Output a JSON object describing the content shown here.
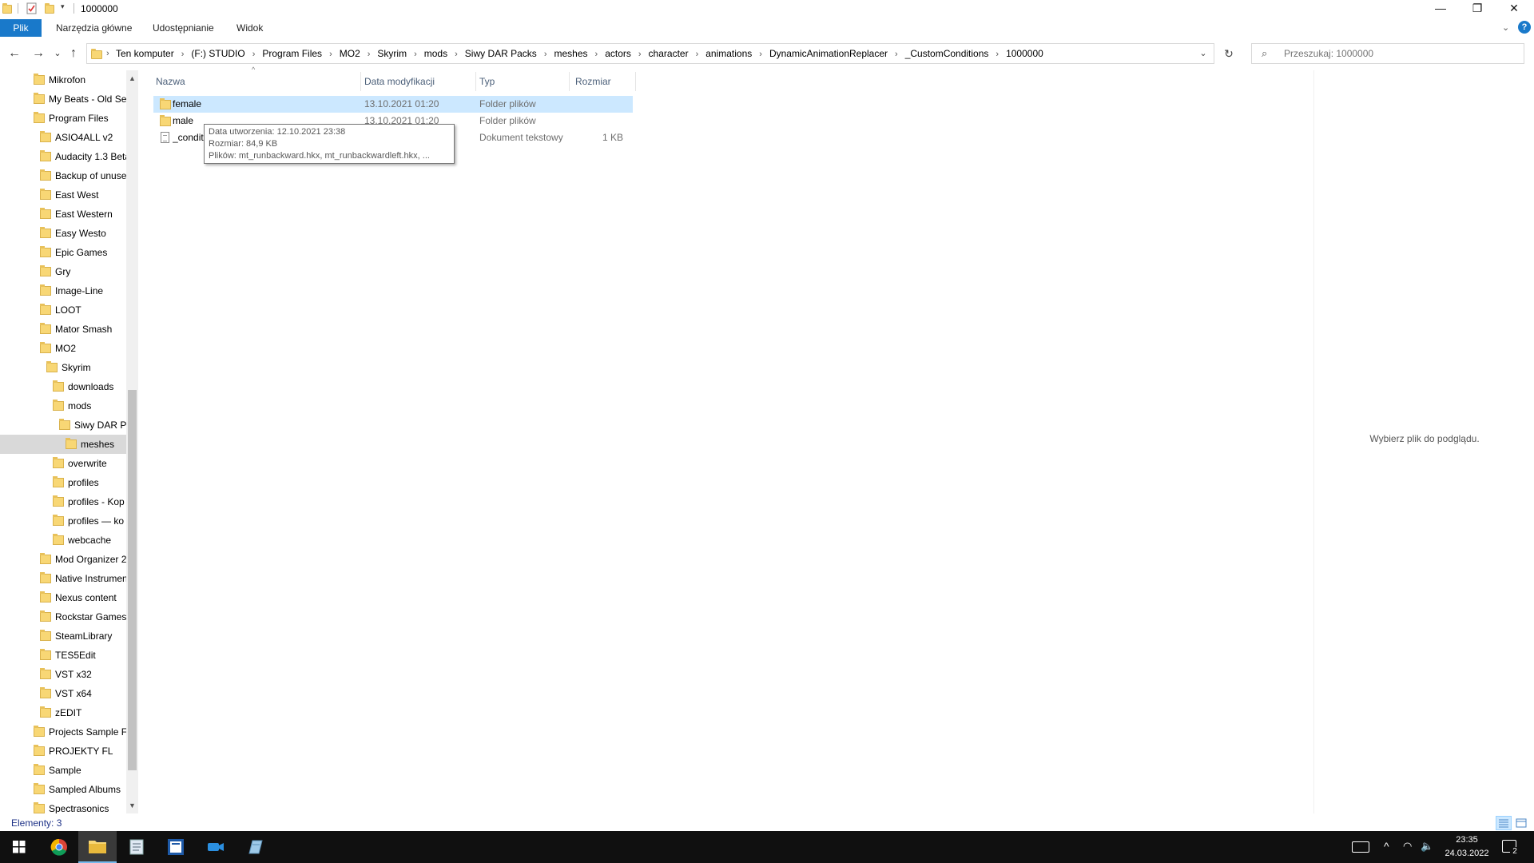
{
  "window": {
    "title": "1000000",
    "minimize_label": "—",
    "maximize_label": "❐",
    "close_label": "✕"
  },
  "ribbon": {
    "tabs": [
      "Plik",
      "Narzędzia główne",
      "Udostępnianie",
      "Widok"
    ],
    "expand_icon": "chevron-down-icon",
    "help_label": "?"
  },
  "address": {
    "back_label": "←",
    "forward_label": "→",
    "recent_label": "⌄",
    "up_label": "↑",
    "crumbs": [
      "Ten komputer",
      "(F:) STUDIO",
      "Program Files",
      "MO2",
      "Skyrim",
      "mods",
      "Siwy DAR Packs",
      "meshes",
      "actors",
      "character",
      "animations",
      "DynamicAnimationReplacer",
      "_CustomConditions",
      "1000000"
    ],
    "separator": "›",
    "refresh_label": "↻"
  },
  "search": {
    "placeholder": "Przeszukaj: 1000000"
  },
  "navpane": {
    "items": [
      {
        "label": "Mikrofon",
        "level": 0
      },
      {
        "label": "My Beats - Old Ser",
        "level": 0
      },
      {
        "label": "Program Files",
        "level": 0
      },
      {
        "label": "ASIO4ALL v2",
        "level": 1
      },
      {
        "label": "Audacity 1.3 Beta",
        "level": 1
      },
      {
        "label": "Backup of unuse",
        "level": 1
      },
      {
        "label": "East West",
        "level": 1
      },
      {
        "label": "East Western",
        "level": 1
      },
      {
        "label": "Easy Westo",
        "level": 1
      },
      {
        "label": "Epic Games",
        "level": 1
      },
      {
        "label": "Gry",
        "level": 1
      },
      {
        "label": "Image-Line",
        "level": 1
      },
      {
        "label": "LOOT",
        "level": 1
      },
      {
        "label": "Mator Smash",
        "level": 1
      },
      {
        "label": "MO2",
        "level": 1
      },
      {
        "label": "Skyrim",
        "level": 2
      },
      {
        "label": "downloads",
        "level": 3
      },
      {
        "label": "mods",
        "level": 3
      },
      {
        "label": "Siwy DAR Pa",
        "level": 4
      },
      {
        "label": "meshes",
        "level": 5,
        "current": true
      },
      {
        "label": "overwrite",
        "level": 3
      },
      {
        "label": "profiles",
        "level": 3
      },
      {
        "label": "profiles - Kop",
        "level": 3
      },
      {
        "label": "profiles — ko",
        "level": 3
      },
      {
        "label": "webcache",
        "level": 3
      },
      {
        "label": "Mod Organizer 2",
        "level": 1
      },
      {
        "label": "Native Instrumen",
        "level": 1
      },
      {
        "label": "Nexus content",
        "level": 1
      },
      {
        "label": "Rockstar Games",
        "level": 1
      },
      {
        "label": "SteamLibrary",
        "level": 1
      },
      {
        "label": "TES5Edit",
        "level": 1
      },
      {
        "label": "VST x32",
        "level": 1
      },
      {
        "label": "VST x64",
        "level": 1
      },
      {
        "label": "zEDIT",
        "level": 1
      },
      {
        "label": "Projects Sample Fo",
        "level": 0
      },
      {
        "label": "PROJEKTY FL",
        "level": 0
      },
      {
        "label": "Sample",
        "level": 0
      },
      {
        "label": "Sampled Albums",
        "level": 0
      },
      {
        "label": "Spectrasonics",
        "level": 0
      }
    ]
  },
  "filelist": {
    "columns": [
      "Nazwa",
      "Data modyfikacji",
      "Typ",
      "Rozmiar"
    ],
    "sort_indicator": "^",
    "rows": [
      {
        "name": "female",
        "date": "13.10.2021 01:20",
        "type": "Folder plików",
        "size": "",
        "icon": "folder-icon",
        "selected": true
      },
      {
        "name": "male",
        "date": "13.10.2021 01:20",
        "type": "Folder plików",
        "size": "",
        "icon": "folder-icon",
        "selected": false
      },
      {
        "name": "_condit",
        "date": "",
        "type": "Dokument tekstowy",
        "size": "1 KB",
        "icon": "text-file-icon",
        "selected": false
      }
    ]
  },
  "tooltip": {
    "line1": "Data utworzenia: 12.10.2021 23:38",
    "line2": "Rozmiar: 84,9 KB",
    "line3": "Plików: mt_runbackward.hkx, mt_runbackwardleft.hkx, ..."
  },
  "preview": {
    "message": "Wybierz plik do podglądu."
  },
  "status": {
    "text": "Elementy: 3"
  },
  "taskbar": {
    "apps": [
      "start-icon",
      "chrome-icon",
      "file-explorer-icon",
      "notepad-icon",
      "notepad-plus-icon",
      "camera-icon",
      "tes5edit-icon"
    ],
    "time": "23:35",
    "date": "24.03.2022",
    "notification_count": "2"
  },
  "colors": {
    "accent": "#1979ca",
    "selection": "#cce8ff",
    "folder": "#f8d775",
    "taskbar": "#101010"
  }
}
